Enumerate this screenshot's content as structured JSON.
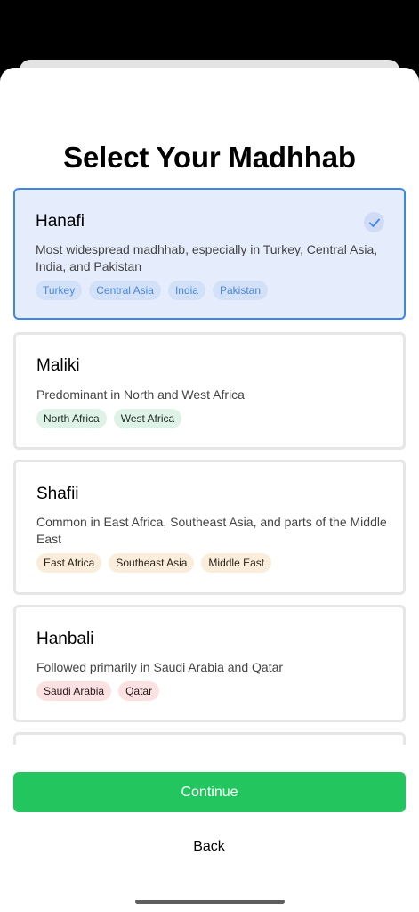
{
  "title": "Select Your Madhhab",
  "madhhabs": [
    {
      "name": "Hanafi",
      "description": "Most widespread madhhab, especially in Turkey, Central Asia, India, and Pakistan",
      "tags": [
        "Turkey",
        "Central Asia",
        "India",
        "Pakistan"
      ],
      "tag_color": "#4a87d8",
      "selected": true
    },
    {
      "name": "Maliki",
      "description": "Predominant in North and West Africa",
      "tags": [
        "North Africa",
        "West Africa"
      ],
      "tag_color": "#dff2e8",
      "selected": false
    },
    {
      "name": "Shafii",
      "description": "Common in East Africa, Southeast Asia, and parts of the Middle East",
      "tags": [
        "East Africa",
        "Southeast Asia",
        "Middle East"
      ],
      "tag_color": "#fbeddc",
      "selected": false
    },
    {
      "name": "Hanbali",
      "description": "Followed primarily in Saudi Arabia and Qatar",
      "tags": [
        "Saudi Arabia",
        "Qatar"
      ],
      "tag_color": "#fbe1e1",
      "selected": false
    }
  ],
  "continue_label": "Continue",
  "back_label": "Back",
  "colors": {
    "accent": "#3e86ec",
    "continue": "#22c55e",
    "selected_bg": "#e5ecfb"
  },
  "icons": {
    "selected_check": "check-icon"
  }
}
